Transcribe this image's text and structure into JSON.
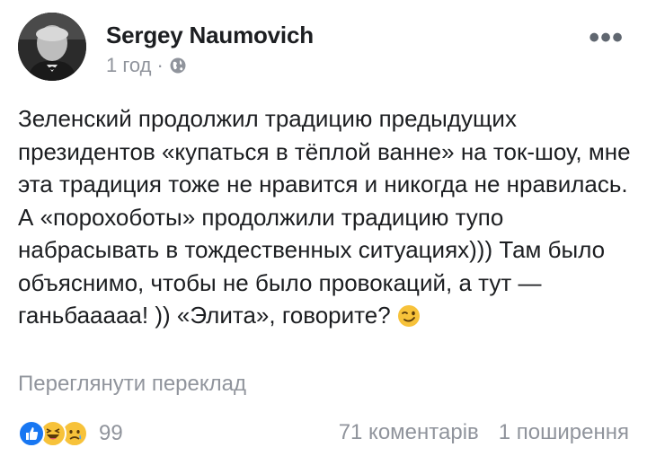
{
  "post": {
    "author": "Sergey Naumovich",
    "time": "1 год",
    "separator": "·",
    "audience_icon": "globe-icon",
    "more_label": "•••",
    "text": "Зеленский продолжил традицию предыдущих президентов «купаться в тёплой ванне» на ток-шоу, мне эта традиция тоже не нравится и никогда не нравилась. А «порохоботы» продолжили традицию тупо набрасывать в тождественных ситуациях))) Там было объяснимо, чтобы не было провокаций, а тут — ганьбааааа! )) «Элита», говорите?",
    "emoji": "wink-emoji-icon",
    "translate_link": "Переглянути переклад"
  },
  "footer": {
    "reactions": [
      "like-icon",
      "haha-icon",
      "sad-icon"
    ],
    "reaction_count": "99",
    "comments": "71 коментарів",
    "shares": "1 поширення"
  },
  "colors": {
    "text": "#1c1e21",
    "secondary": "#90949c",
    "like": "#1877f2",
    "emoji_yellow": "#f7c23a"
  }
}
